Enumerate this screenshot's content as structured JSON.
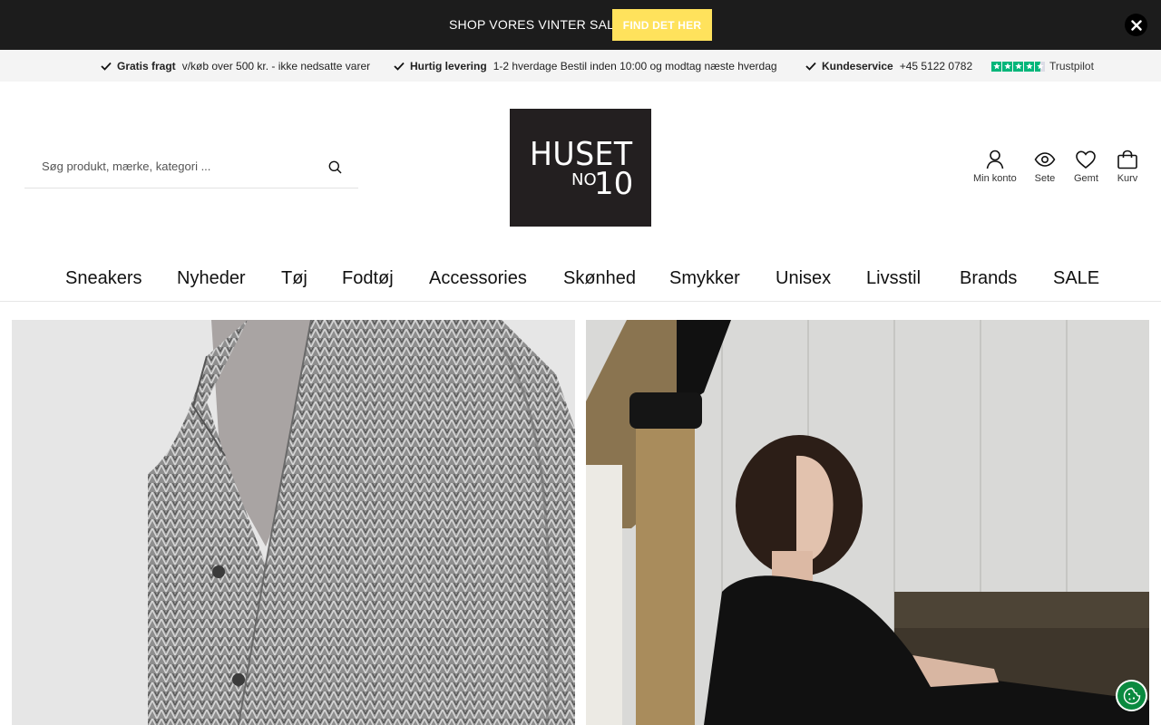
{
  "promo": {
    "text": "SHOP VORES VINTER SALE",
    "button_label": "FIND DET HER",
    "accent_color": "#ffe25c"
  },
  "usp": [
    {
      "title": "Gratis fragt",
      "detail": "v/køb over 500 kr. - ikke nedsatte varer"
    },
    {
      "title": "Hurtig levering",
      "detail": "1-2 hverdage Bestil inden 10:00 og modtag næste hverdag"
    },
    {
      "title": "Kundeservice",
      "detail": "+45 5122 0782"
    }
  ],
  "trustpilot": {
    "label": "Trustpilot",
    "rating_stars": 4.5,
    "color": "#00b67a"
  },
  "search": {
    "placeholder": "Søg produkt, mærke, kategori ..."
  },
  "logo": {
    "line1": "HUSET",
    "line2_no": "NO",
    "line2_num": "10"
  },
  "account": {
    "my_account": "Min konto",
    "seen": "Sete",
    "saved": "Gemt",
    "cart": "Kurv"
  },
  "nav": [
    "Sneakers",
    "Nyheder",
    "Tøj",
    "Fodtøj",
    "Accessories",
    "Skønhed",
    "Smykker",
    "Unisex",
    "Livsstil",
    "Brands",
    "SALE"
  ]
}
